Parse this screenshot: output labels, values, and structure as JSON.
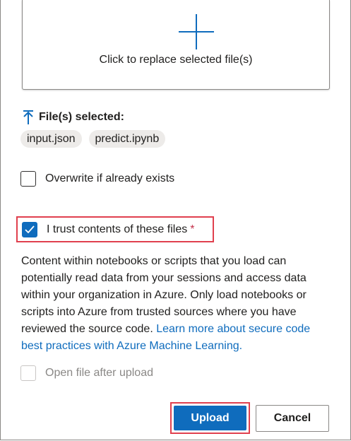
{
  "dropzone": {
    "text": "Click to replace selected file(s)",
    "icon": "plus-icon"
  },
  "files": {
    "heading": "File(s) selected:",
    "icon": "up-arrow-icon",
    "items": [
      "input.json",
      "predict.ipynb"
    ]
  },
  "options": {
    "overwrite_label": "Overwrite if already exists",
    "overwrite_checked": false,
    "trust_label": "I trust contents of these files",
    "trust_required": "*",
    "trust_checked": true,
    "open_file_label": "Open file after upload",
    "open_file_checked": false,
    "open_file_disabled": true
  },
  "description": {
    "text": "Content within notebooks or scripts that you load can potentially read data from your sessions and access data within your organization in Azure. Only load notebooks or scripts into Azure from trusted sources where you have reviewed the source code.",
    "link": "Learn more about secure code best practices with Azure Machine Learning."
  },
  "buttons": {
    "upload": "Upload",
    "cancel": "Cancel"
  },
  "colors": {
    "accent": "#0f6cbd",
    "highlight": "#e0404e"
  }
}
